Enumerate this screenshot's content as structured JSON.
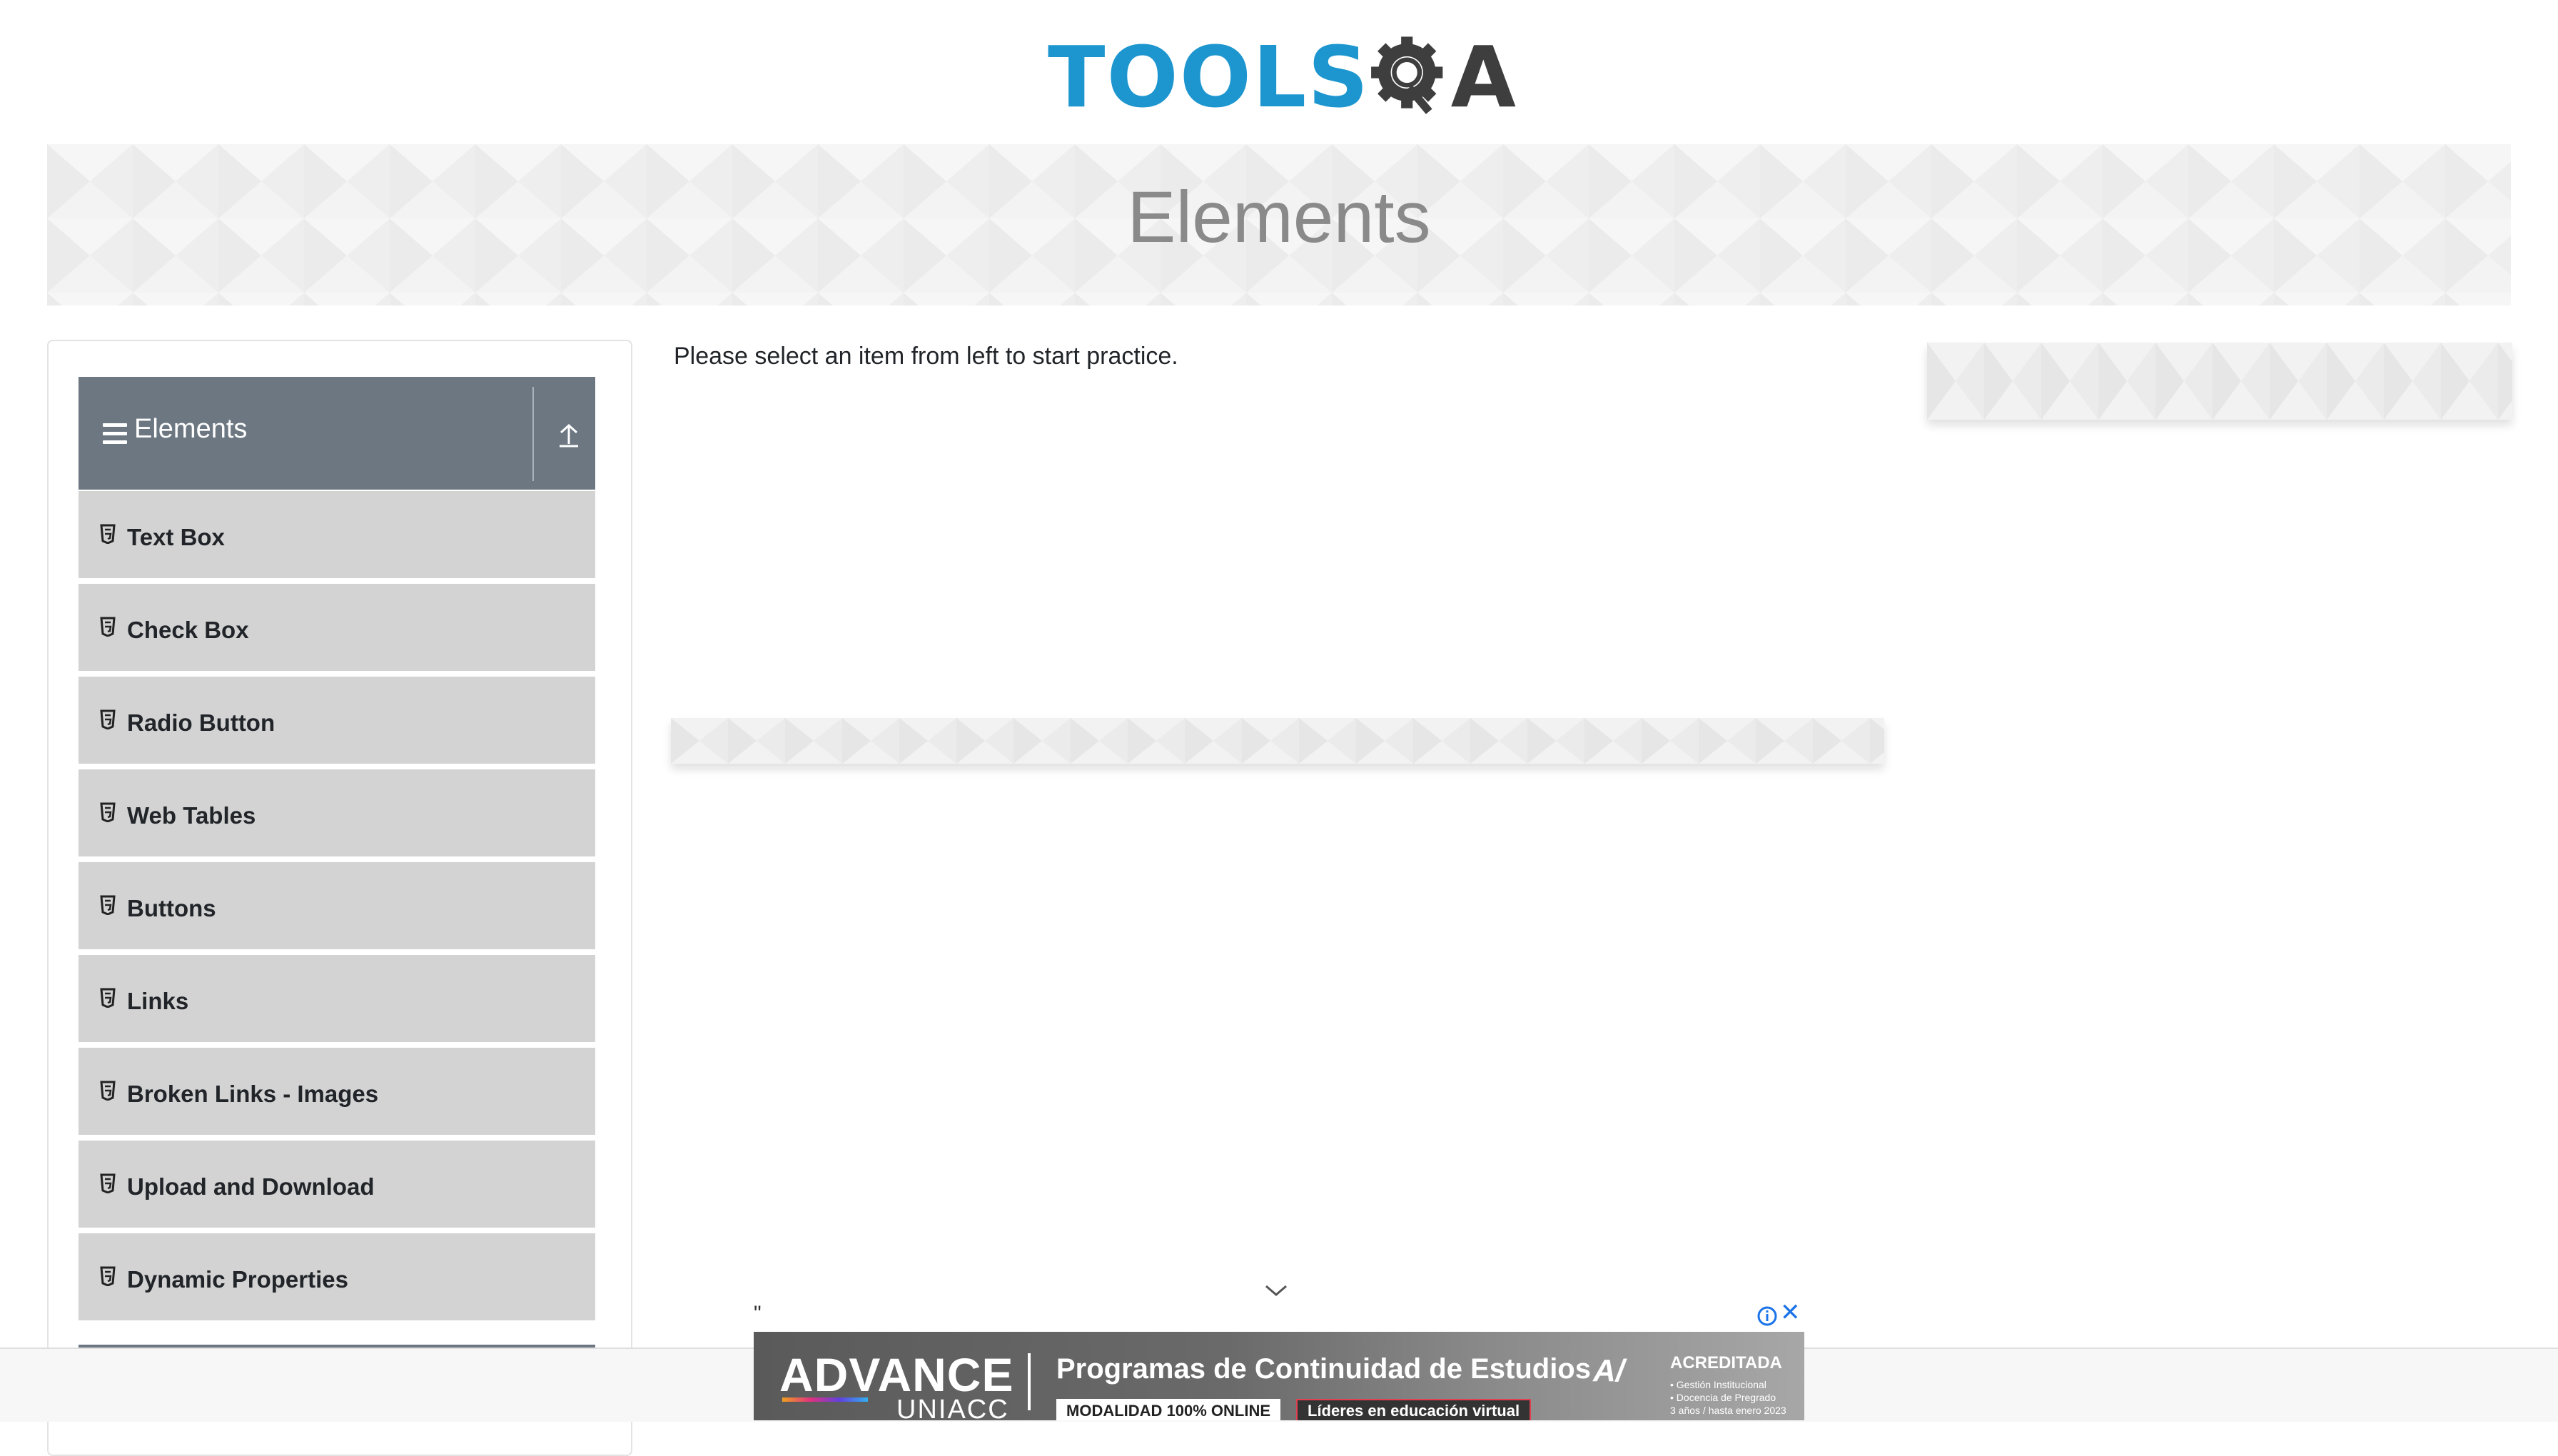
{
  "logo": {
    "part1": "TOOLS",
    "part2": "A",
    "colors": {
      "blue": "#1d96cf",
      "dark": "#3e3e3e"
    }
  },
  "banner": {
    "title": "Elements"
  },
  "sidebar": {
    "group_title": "Elements",
    "items": [
      {
        "label": "Text Box"
      },
      {
        "label": "Check Box"
      },
      {
        "label": "Radio Button"
      },
      {
        "label": "Web Tables"
      },
      {
        "label": "Buttons"
      },
      {
        "label": "Links"
      },
      {
        "label": "Broken Links - Images"
      },
      {
        "label": "Upload and Download"
      },
      {
        "label": "Dynamic Properties"
      }
    ],
    "colors": {
      "header": "#6c7782",
      "item": "#d3d3d3"
    }
  },
  "main": {
    "intro": "Please select an item from left to start practice."
  },
  "ad": {
    "quote": "\"",
    "close": "✕",
    "brand": "ADVANCE",
    "brand_sub": "UNIACC",
    "headline": "Programas de Continuidad de Estudios",
    "pill1": "MODALIDAD 100% ONLINE",
    "pill2": "Líderes en educación virtual",
    "acr_logo": "A/",
    "acr_title": "ACREDITADA",
    "acr_line1": "• Gestión Institucional",
    "acr_line2": "• Docencia de Pregrado",
    "acr_line3": "3 años / hasta enero 2023"
  }
}
